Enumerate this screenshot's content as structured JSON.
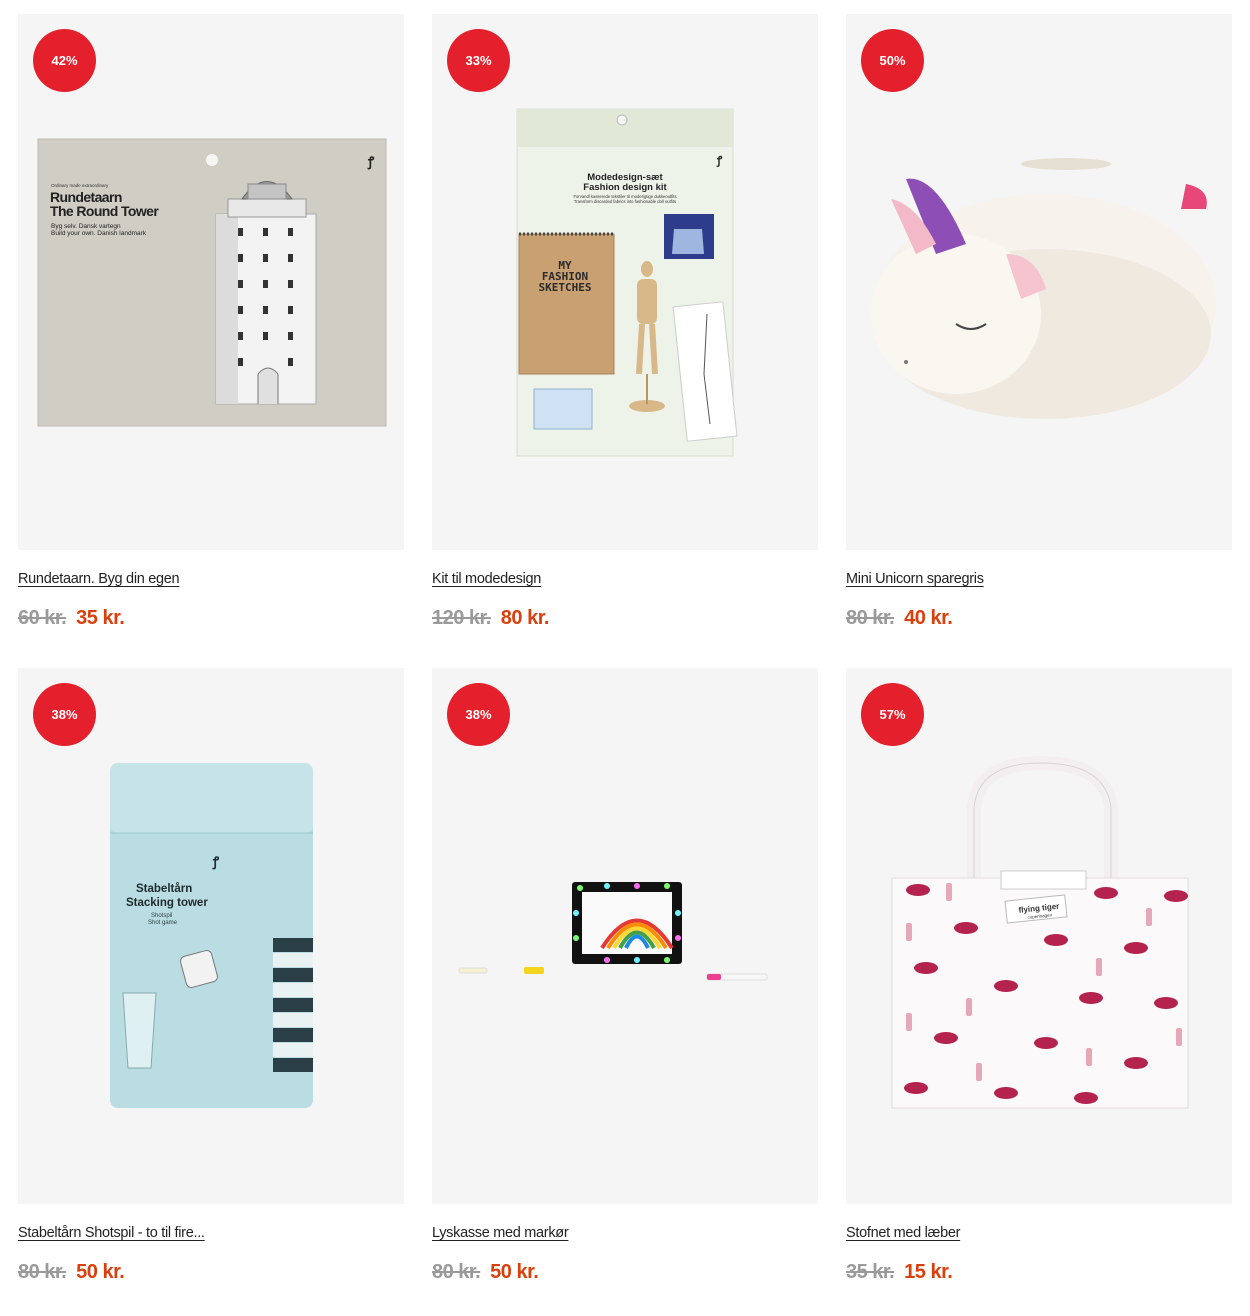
{
  "products": [
    {
      "title": "Rundetaarn. Byg din egen",
      "discount": "42%",
      "old_price": "60 kr.",
      "new_price": "35 kr.",
      "image": {
        "small_line": "Ordinary made extraordinary",
        "title_1": "Rundetaarn",
        "title_2": "The Round Tower",
        "sub_1": "Byg selv. Dansk vartegn",
        "sub_2": "Build your own. Danish landmark"
      }
    },
    {
      "title": "Kit til modedesign",
      "discount": "33%",
      "old_price": "120 kr.",
      "new_price": "80 kr.",
      "image": {
        "title_1": "Modedesign-sæt",
        "title_2": "Fashion design kit",
        "sub_1": "Forvandl kasserede tekstiler til moderigtige dukkeoutfits",
        "sub_2": "Transform discarded fabrics into fashionable doll outfits",
        "sketch_1": "MY",
        "sketch_2": "FASHION",
        "sketch_3": "SKETCHES"
      }
    },
    {
      "title": "Mini Unicorn sparegris",
      "discount": "50%",
      "old_price": "80 kr.",
      "new_price": "40 kr."
    },
    {
      "title": "Stabeltårn Shotspil - to til fire...",
      "discount": "38%",
      "old_price": "80 kr.",
      "new_price": "50 kr.",
      "image": {
        "title_1": "Stabeltårn",
        "title_2": "Stacking tower",
        "sub_1": "Shotspil",
        "sub_2": "Shot game"
      }
    },
    {
      "title": "Lyskasse med markør",
      "discount": "38%",
      "old_price": "80 kr.",
      "new_price": "50 kr."
    },
    {
      "title": "Stofnet med læber",
      "discount": "57%",
      "old_price": "35 kr.",
      "new_price": "15 kr.",
      "image": {
        "brand_1": "flying tiger",
        "brand_2": "copenhagen"
      }
    }
  ],
  "colors": {
    "badge": "#e3202b",
    "new_price": "#d9400d",
    "old_price": "#9a9a9a",
    "image_bg": "#f5f5f5"
  }
}
